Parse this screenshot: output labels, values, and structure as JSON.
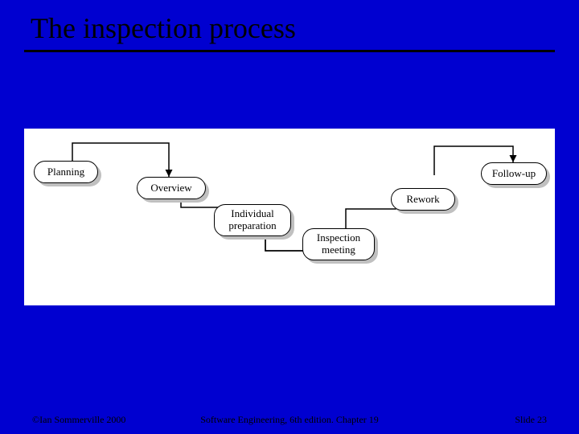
{
  "title": "The inspection process",
  "nodes": {
    "planning": "Planning",
    "overview": "Overview",
    "individual_preparation": "Individual\npreparation",
    "inspection_meeting": "Inspection\nmeeting",
    "rework": "Rework",
    "follow_up": "Follow-up"
  },
  "footer": {
    "left": "©Ian Sommerville 2000",
    "center": "Software Engineering, 6th edition. Chapter 19",
    "right": "Slide 23"
  },
  "chart_data": {
    "type": "flow",
    "title": "The inspection process",
    "nodes": [
      {
        "id": "planning",
        "label": "Planning"
      },
      {
        "id": "overview",
        "label": "Overview"
      },
      {
        "id": "individual_preparation",
        "label": "Individual preparation"
      },
      {
        "id": "inspection_meeting",
        "label": "Inspection meeting"
      },
      {
        "id": "rework",
        "label": "Rework"
      },
      {
        "id": "follow_up",
        "label": "Follow-up"
      }
    ],
    "edges": [
      {
        "from": "planning",
        "to": "overview"
      },
      {
        "from": "overview",
        "to": "individual_preparation"
      },
      {
        "from": "individual_preparation",
        "to": "inspection_meeting"
      },
      {
        "from": "inspection_meeting",
        "to": "rework"
      },
      {
        "from": "rework",
        "to": "follow_up"
      }
    ]
  }
}
